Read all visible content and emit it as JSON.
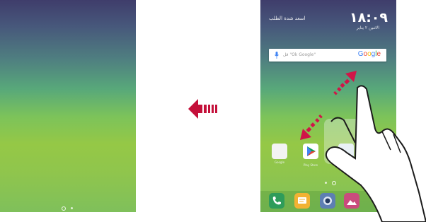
{
  "right_screen": {
    "status_info": "اسعد شدة الطلب",
    "clock_time": "١٨:٠٩",
    "clock_date": "الاثنين ٢ يناير",
    "search_hint": "قل \"Ok Google\"",
    "google_logo": "Google"
  },
  "home_apps": [
    {
      "label": "Google"
    },
    {
      "label": "Play Store"
    },
    {
      "label": ""
    }
  ],
  "dock": [
    {
      "icon": "phone-icon",
      "color": "#2e9c5a"
    },
    {
      "icon": "messages-icon",
      "color": "#f2b233"
    },
    {
      "icon": "camera-icon",
      "color": "#5d7fb3"
    },
    {
      "icon": "gallery-icon",
      "color": "#c94b7d"
    }
  ],
  "colors": {
    "arrow": "#c4103a",
    "gesture_arrow": "#d01548"
  }
}
